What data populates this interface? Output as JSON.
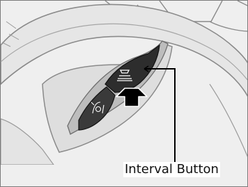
{
  "callout": {
    "label": "Interval Button"
  },
  "icons": {
    "upper_button_icon": "distance-setting-icon",
    "lower_button_icon": "lane-keeping-icon"
  }
}
